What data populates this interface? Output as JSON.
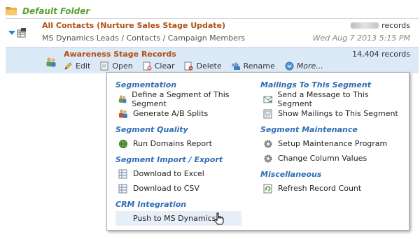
{
  "folder": {
    "title": "Default Folder"
  },
  "all_contacts": {
    "title": "All Contacts (Nurture Sales Stage Update)",
    "path": "MS Dynamics Leads / Contacts / Campaign Members",
    "records_suffix": "records",
    "date": "Wed Aug 7 2013 5:15 PM"
  },
  "segment": {
    "title": "Awareness Stage Records",
    "records": "14,404 records",
    "actions": {
      "edit": "Edit",
      "open": "Open",
      "clear": "Clear",
      "delete": "Delete",
      "rename": "Rename",
      "more": "More..."
    }
  },
  "menu": {
    "left": [
      {
        "title": "Segmentation",
        "items": [
          "Define a Segment of This Segment",
          "Generate A/B Splits"
        ]
      },
      {
        "title": "Segment Quality",
        "items": [
          "Run Domains Report"
        ]
      },
      {
        "title": "Segment Import / Export",
        "items": [
          "Download to Excel",
          "Download to CSV"
        ]
      },
      {
        "title": "CRM Integration",
        "items": [
          "Push to MS Dynamics"
        ]
      }
    ],
    "right": [
      {
        "title": "Mailings To This Segment",
        "items": [
          "Send a Message to This Segment",
          "Show Mailings to This Segment"
        ]
      },
      {
        "title": "Segment Maintenance",
        "items": [
          "Setup Maintenance Program",
          "Change Column Values"
        ]
      },
      {
        "title": "Miscellaneous",
        "items": [
          "Refresh Record Count"
        ]
      }
    ]
  },
  "colors": {
    "folder_title": "#5aa02c",
    "item_title": "#b24f12",
    "section_title": "#2f6db5",
    "selected_row": "#dce9f7"
  },
  "icons": {
    "folder": "folder-icon",
    "expand": "expand-triangle-icon",
    "segment": "people-icon",
    "edit": "pencil-icon",
    "open": "open-icon",
    "clear": "clear-icon",
    "delete": "delete-icon",
    "rename": "rename-icon",
    "more": "more-icon",
    "cursor": "hand-cursor-icon"
  }
}
